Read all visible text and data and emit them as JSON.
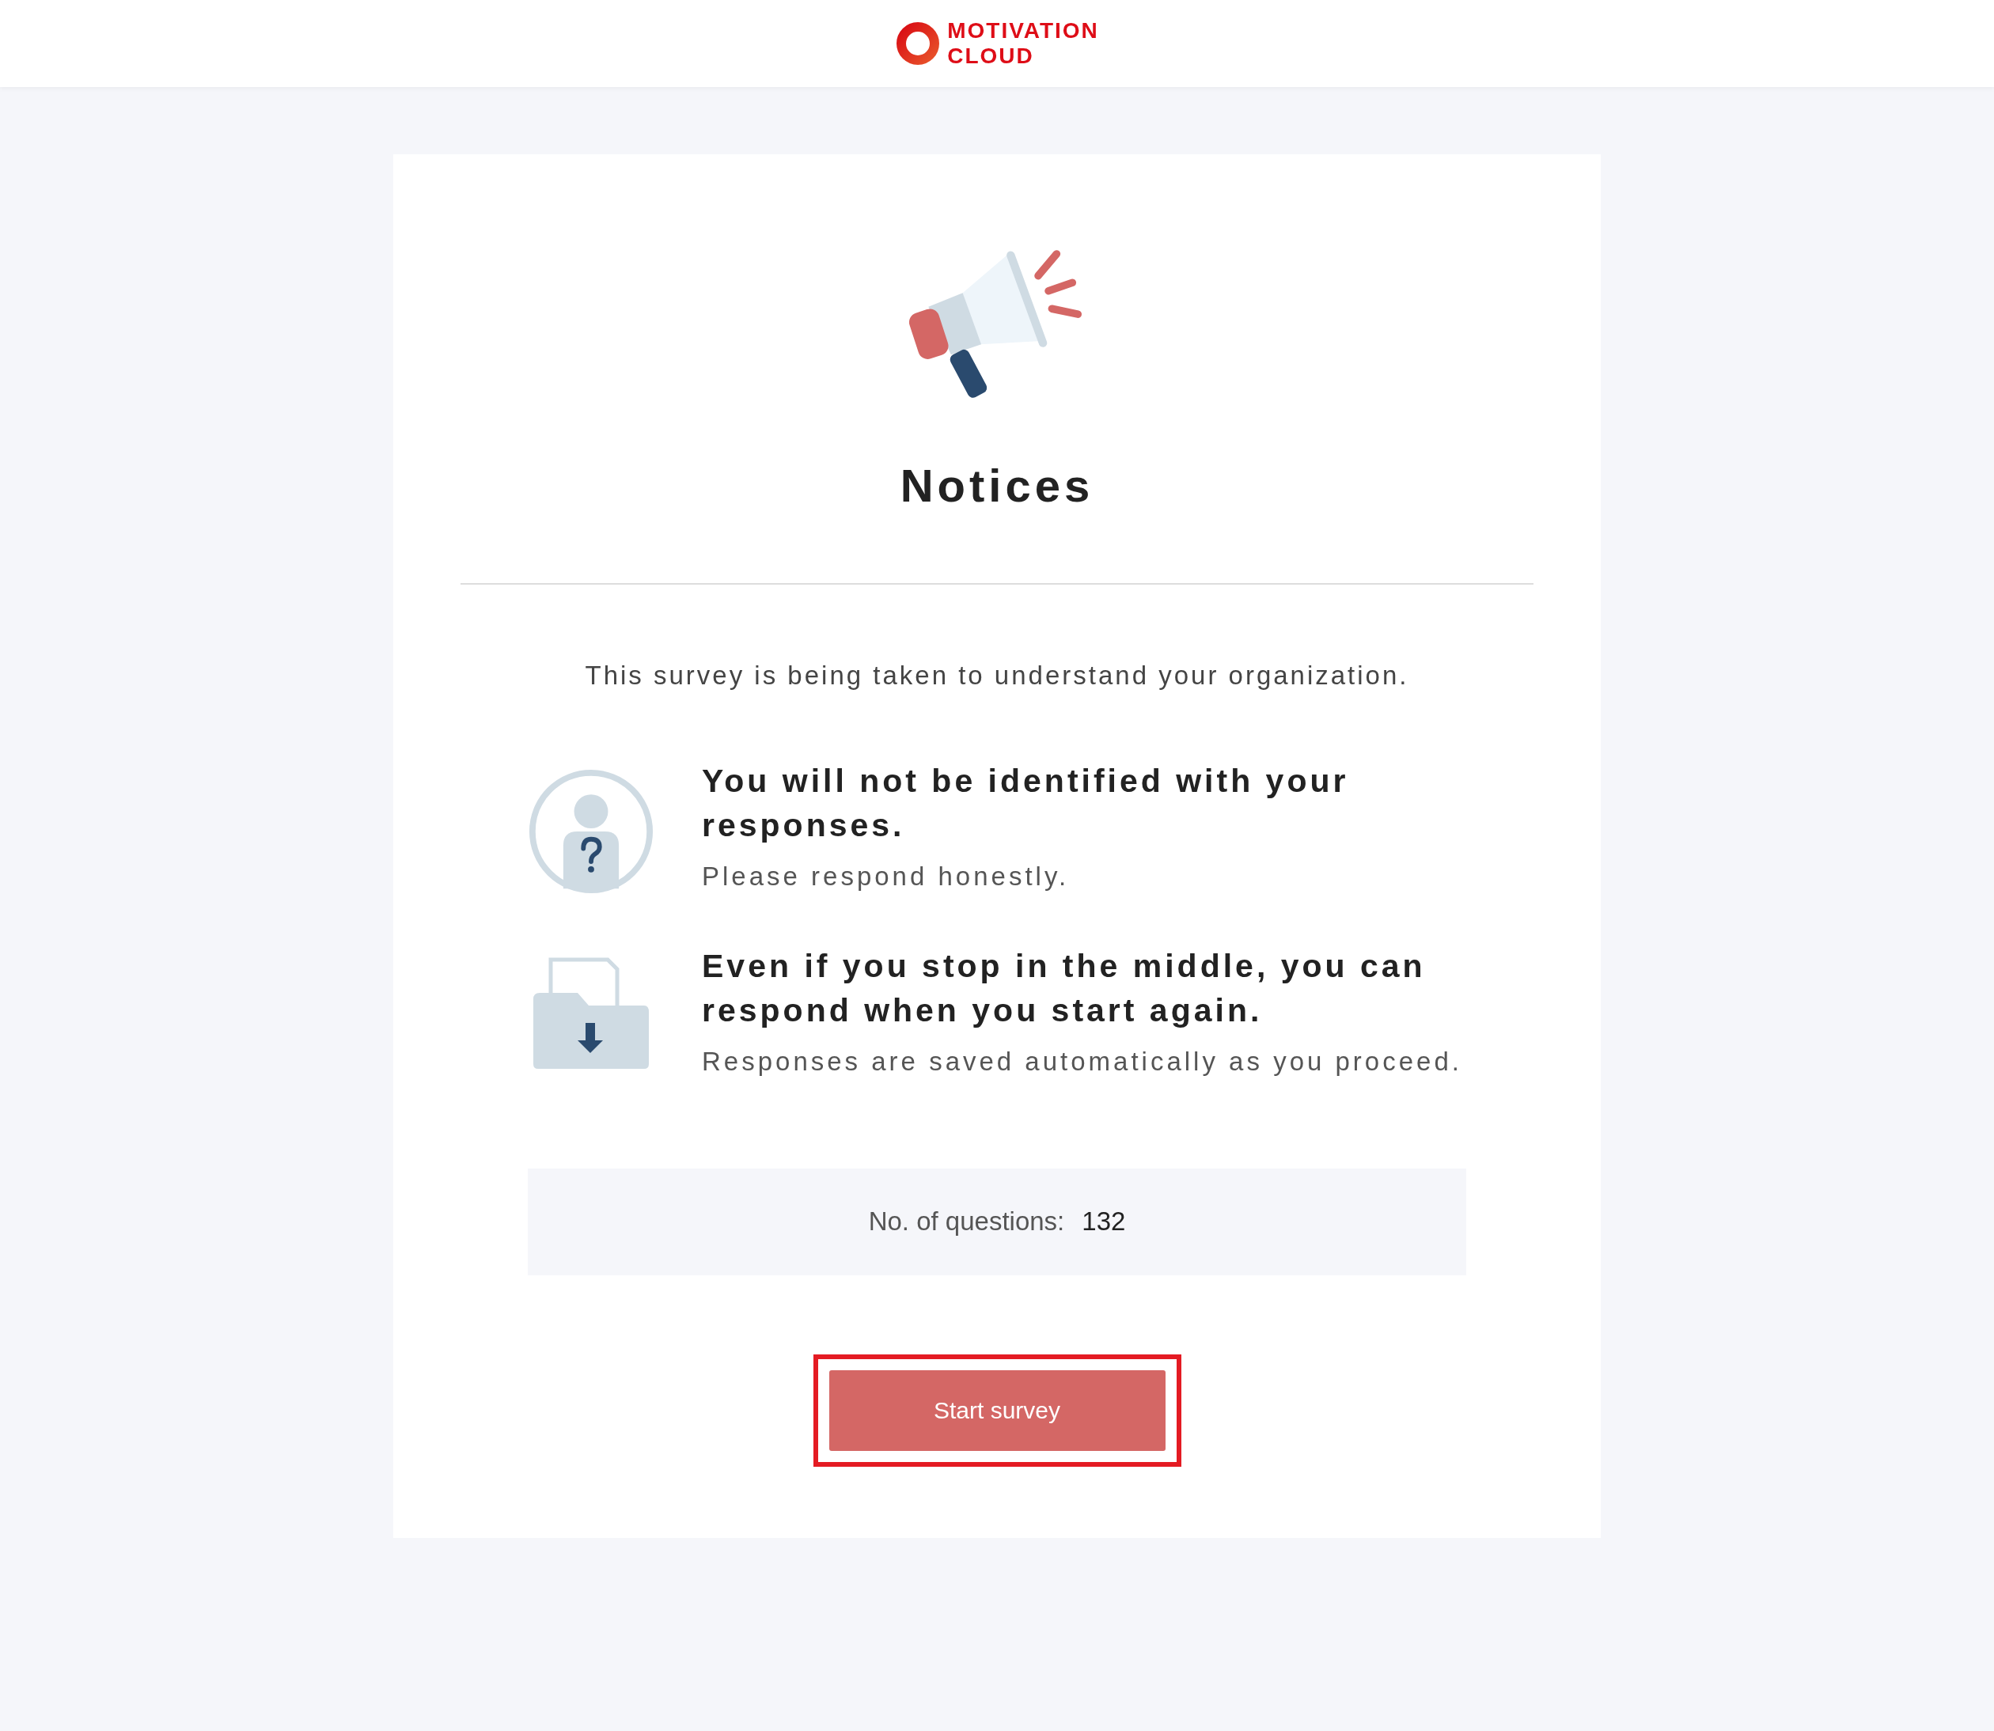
{
  "header": {
    "logo_line_1": "MOTIVATION",
    "logo_line_2": "CLOUD"
  },
  "card": {
    "title": "Notices",
    "intro": "This survey is being taken to understand your organization.",
    "notices": [
      {
        "kind": "anonymous",
        "heading": "You will not be identified with your responses.",
        "text": "Please respond honestly."
      },
      {
        "kind": "save",
        "heading": "Even if you stop in the middle, you can respond when you start again.",
        "text": "Responses are saved automatically as you proceed."
      }
    ],
    "questions_label": "No. of questions:",
    "questions_count": "132",
    "start_button": {
      "label": "Start survey",
      "highlighted": true
    }
  }
}
